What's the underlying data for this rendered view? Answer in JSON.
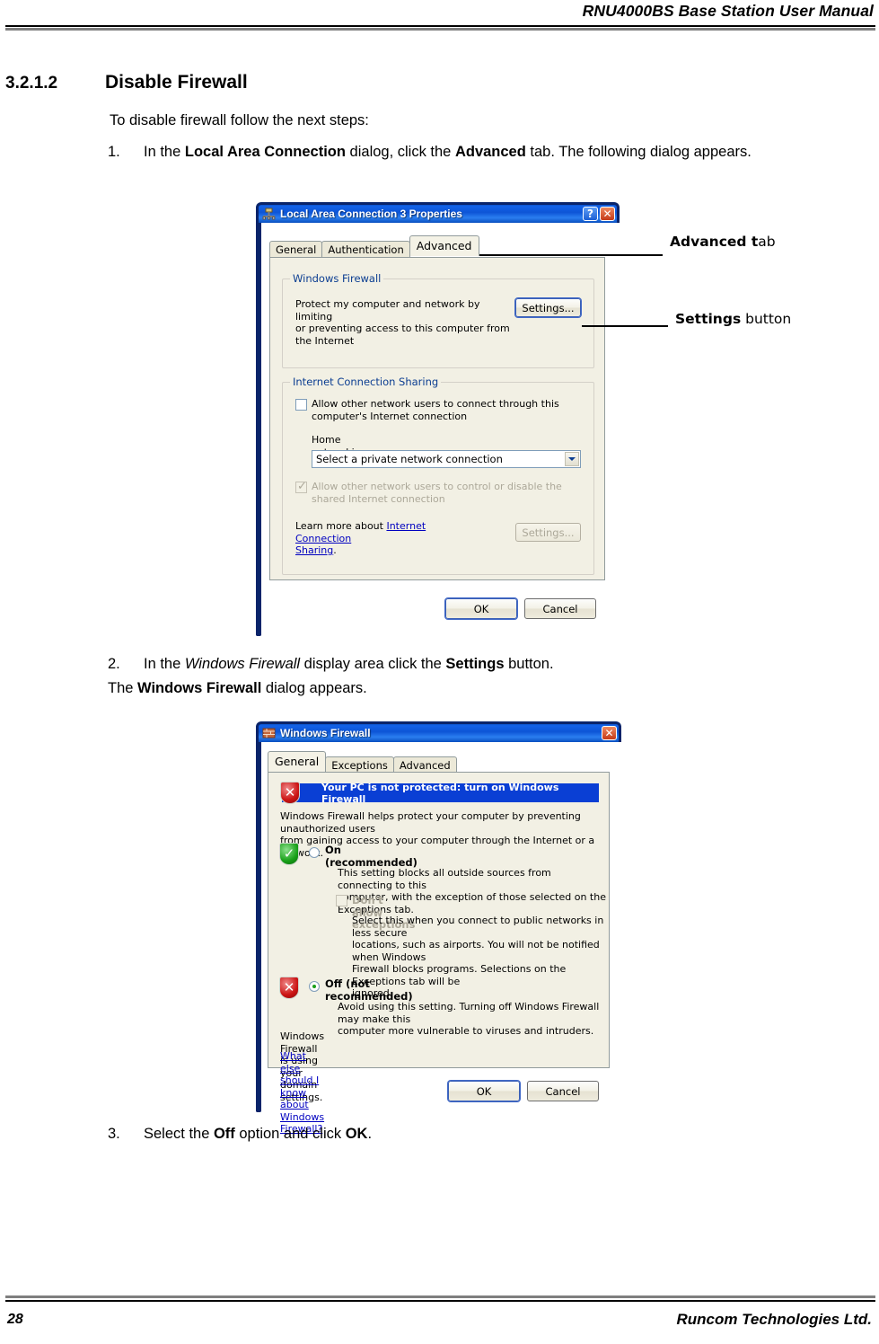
{
  "page": {
    "header_title": "RNU4000BS Base Station User Manual",
    "page_number": "28",
    "company": "Runcom Technologies Ltd."
  },
  "section": {
    "number": "3.2.1.2",
    "title": "Disable Firewall",
    "intro": "To disable firewall follow the next steps:"
  },
  "steps": {
    "step1_num": "1.",
    "step1_a": "In the ",
    "step1_b1": "Local Area Connection",
    "step1_c": " dialog, click the ",
    "step1_b2": "Advanced",
    "step1_d": " tab. The following dialog appears.",
    "step2_num": "2.",
    "step2_a": "In the ",
    "step2_i": "Windows Firewall",
    "step2_b": " display area click the ",
    "step2_bold": "Settings",
    "step2_c": " button.",
    "substep": "The ",
    "substep_bold": "Windows Firewall",
    "substep_tail": " dialog appears.",
    "step3_num": "3.",
    "step3_a": "Select the ",
    "step3_b1": "Off",
    "step3_b": " option and click ",
    "step3_b2": "OK",
    "step3_c": "."
  },
  "annotations": [
    {
      "bold": "Advanced t",
      "rest": "ab"
    },
    {
      "bold": "Settings",
      "rest": " button"
    }
  ],
  "dialog1": {
    "title": "Local Area Connection 3 Properties",
    "title_icon": "network-adapter-icon",
    "help_btn": "?",
    "close_btn": "✕",
    "tabs": [
      {
        "label": "General",
        "active": false
      },
      {
        "label": "Authentication",
        "active": false
      },
      {
        "label": "Advanced",
        "active": true
      }
    ],
    "firewall_group": {
      "label": "Windows Firewall",
      "description_l1": "Protect my computer and network by limiting",
      "description_l2": "or preventing access to this computer from",
      "description_l3": "the Internet",
      "settings_button": "Settings..."
    },
    "ics_group": {
      "label": "Internet Connection Sharing",
      "check1_l1": "Allow other network users to connect through this",
      "check1_l2": "computer's Internet connection",
      "check1_checked": false,
      "combo_label": "Home networking connection:",
      "combo_value": "Select a private network connection",
      "check2_l1": "Allow other network users to control or disable the",
      "check2_l2": "shared Internet connection",
      "check2_checked": true,
      "check2_disabled": true,
      "learn_prefix": "Learn more about ",
      "learn_link_l1": "Internet Connection",
      "learn_link_l2": "Sharing",
      "learn_suffix": ".",
      "settings_button": "Settings...",
      "settings_disabled": true
    },
    "ok_button": "OK",
    "cancel_button": "Cancel"
  },
  "dialog2": {
    "title": "Windows Firewall",
    "title_icon": "windows-firewall-icon",
    "close_btn": "✕",
    "tabs": [
      {
        "label": "General",
        "active": true
      },
      {
        "label": "Exceptions",
        "active": false
      },
      {
        "label": "Advanced",
        "active": false
      }
    ],
    "banner_text": "Your PC is not protected: turn on Windows Firewall",
    "banner_color": "#0a3fd4",
    "intro_l1": "Windows Firewall helps protect your computer by preventing unauthorized users",
    "intro_l2": "from gaining access to your computer through the Internet or a network.",
    "on_option": {
      "label": "On (recommended)",
      "selected": false,
      "desc_l1": "This setting blocks all outside sources from connecting to this",
      "desc_l2": "computer, with the exception of those selected on the Exceptions tab.",
      "sub_check_label": "Don't allow exceptions",
      "sub_check_checked": false,
      "sub_check_disabled": true,
      "sub_desc_l1": "Select this when you connect to public networks in less secure",
      "sub_desc_l2": "locations, such as airports. You will not be notified when Windows",
      "sub_desc_l3": "Firewall blocks programs. Selections on the Exceptions tab will be",
      "sub_desc_l4": "ignored."
    },
    "off_option": {
      "label": "Off (not recommended)",
      "selected": true,
      "desc_l1": "Avoid using this setting. Turning off Windows Firewall may make this",
      "desc_l2": "computer more vulnerable to viruses and intruders."
    },
    "domain_note": "Windows Firewall is using your domain settings.",
    "help_link": "What else should I know about Windows Firewall?",
    "ok_button": "OK",
    "cancel_button": "Cancel"
  }
}
